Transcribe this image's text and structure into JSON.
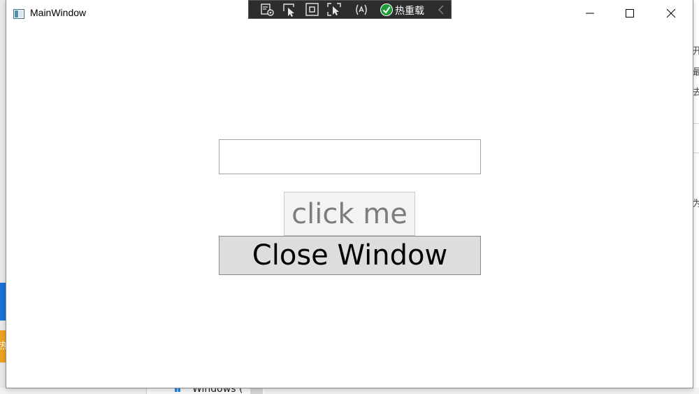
{
  "window": {
    "title": "MainWindow"
  },
  "dev_toolbar": {
    "icons": [
      "live-visual-tree-icon",
      "select-element-icon",
      "display-layout-adorners-icon",
      "track-focus-icon",
      "binding-failures-icon"
    ],
    "hot_reload_label": "热重载",
    "hot_reload_status": "applied"
  },
  "main": {
    "input_value": "",
    "click_button_label": "click me",
    "close_button_label": "Close Window"
  },
  "background": {
    "right_fragments": [
      "开",
      "最",
      "去",
      "为"
    ],
    "left_fragment": "热",
    "bottom_text": "Windows ("
  },
  "colors": {
    "toolbar_bg": "#2d2d2d",
    "hot_reload_green": "#1e9e3a",
    "close_button_bg": "#dddddd",
    "click_button_bg": "#f3f3f3",
    "click_button_text": "#7d7d7d"
  }
}
